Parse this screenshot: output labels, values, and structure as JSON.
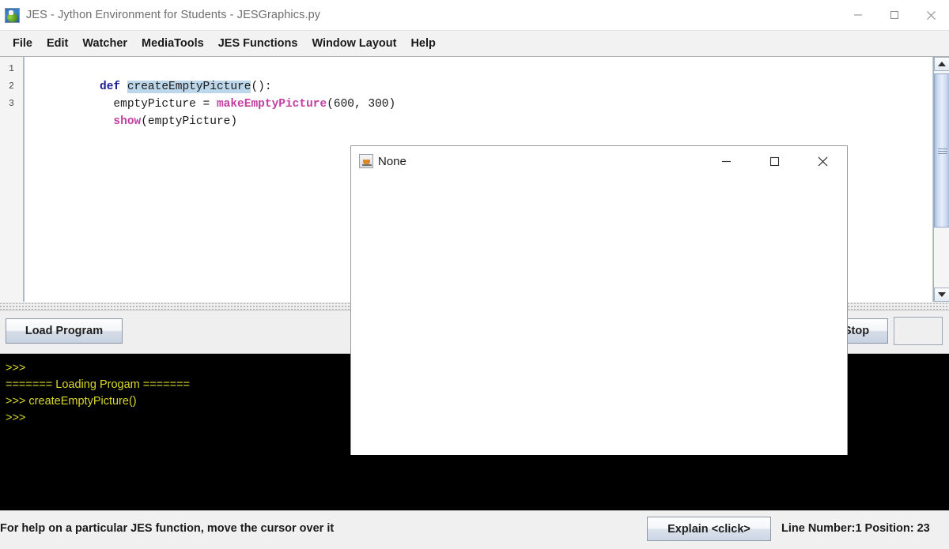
{
  "window": {
    "title": "JES - Jython Environment for Students - JESGraphics.py",
    "icon": "jes-app-icon",
    "controls": [
      {
        "name": "minimize",
        "glyph": "minimize-icon"
      },
      {
        "name": "maximize",
        "glyph": "maximize-icon"
      },
      {
        "name": "close",
        "glyph": "close-icon"
      }
    ]
  },
  "menubar": {
    "items": [
      {
        "label": "File"
      },
      {
        "label": "Edit"
      },
      {
        "label": "Watcher"
      },
      {
        "label": "MediaTools"
      },
      {
        "label": "JES Functions"
      },
      {
        "label": "Window Layout"
      },
      {
        "label": "Help"
      }
    ]
  },
  "editor": {
    "line_numbers": [
      "1",
      "2",
      "3"
    ],
    "lines": [
      {
        "number": "1",
        "tokens": [
          {
            "text": "def",
            "style": "kw-def"
          },
          {
            "text": " ",
            "style": "plain"
          },
          {
            "text": "createEmptyPicture",
            "style": "sel"
          },
          {
            "text": "():",
            "style": "plain"
          }
        ]
      },
      {
        "number": "2",
        "tokens": [
          {
            "text": "  emptyPicture = ",
            "style": "plain"
          },
          {
            "text": "makeEmptyPicture",
            "style": "fn-name"
          },
          {
            "text": "(600, 300)",
            "style": "plain"
          }
        ]
      },
      {
        "number": "3",
        "tokens": [
          {
            "text": "  ",
            "style": "plain"
          },
          {
            "text": "show",
            "style": "fn-name"
          },
          {
            "text": "(emptyPicture)",
            "style": "plain"
          }
        ]
      }
    ],
    "scrollbar": {
      "up_arrow": "scroll-up-icon",
      "down_arrow": "scroll-down-icon"
    }
  },
  "toolbar": {
    "load_program_label": "Load Program",
    "stop_label": "Stop",
    "extra_label": ""
  },
  "console": {
    "lines": [
      ">>>",
      "======= Loading Progam =======",
      ">>> createEmptyPicture()",
      ">>>"
    ]
  },
  "statusbar": {
    "help_text": "For help on a particular JES function, move the cursor over it",
    "explain_label": "Explain <click>",
    "position_text": "Line Number:1 Position: 23"
  },
  "dialog": {
    "title": "None",
    "icon": "java-cup-icon",
    "controls": [
      {
        "name": "minimize",
        "glyph": "minimize-icon"
      },
      {
        "name": "maximize",
        "glyph": "maximize-icon"
      },
      {
        "name": "close",
        "glyph": "close-icon"
      }
    ]
  },
  "colors": {
    "keyword": "#1d1d9c",
    "function": "#c23fa0",
    "selection": "#bcd6ea",
    "console_bg": "#000000",
    "console_text": "#d8d82b"
  }
}
